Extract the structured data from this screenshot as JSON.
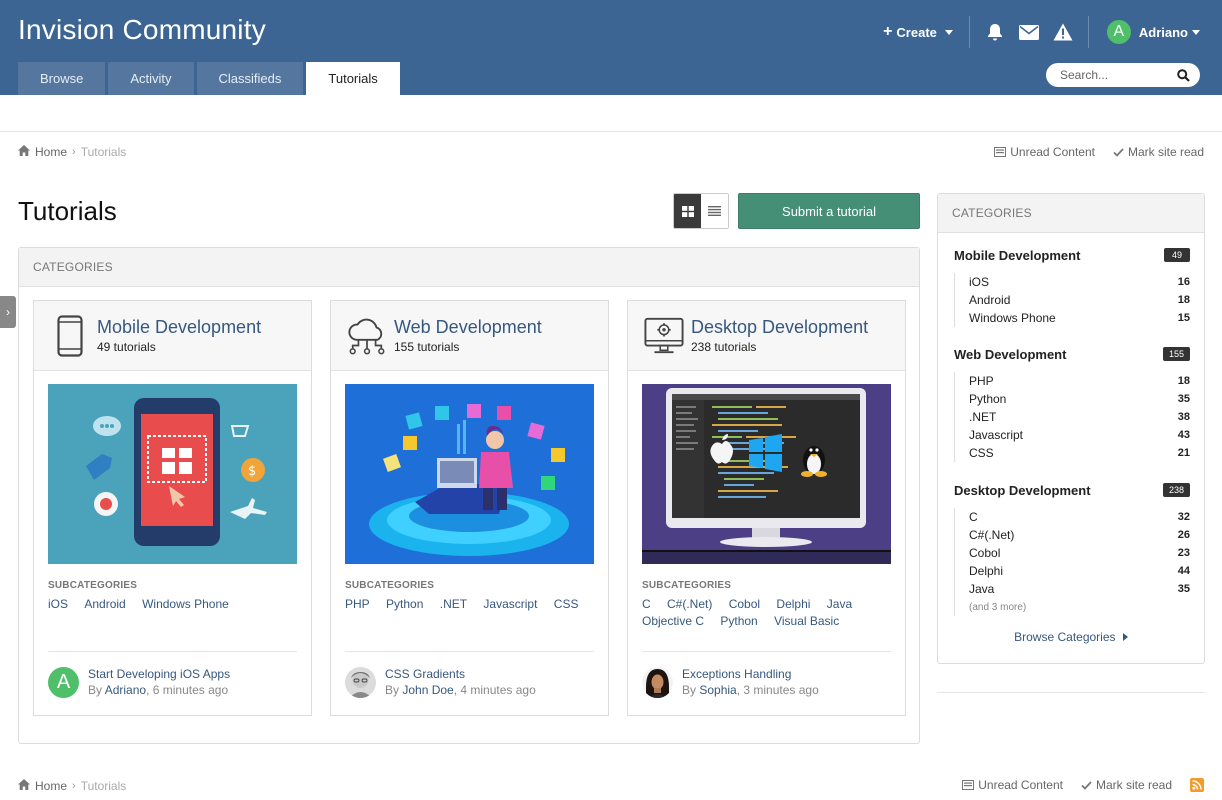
{
  "header": {
    "site_title": "Invision Community",
    "create_label": "Create",
    "user_name": "Adriano",
    "user_initial": "A",
    "search_placeholder": "Search..."
  },
  "nav": {
    "tabs": [
      {
        "label": "Browse",
        "active": false
      },
      {
        "label": "Activity",
        "active": false
      },
      {
        "label": "Classifieds",
        "active": false
      },
      {
        "label": "Tutorials",
        "active": true
      }
    ]
  },
  "breadcrumb": {
    "home": "Home",
    "current": "Tutorials",
    "unread": "Unread Content",
    "mark_read": "Mark site read"
  },
  "page": {
    "title": "Tutorials",
    "submit_label": "Submit a tutorial",
    "categories_header": "CATEGORIES",
    "subcategories_label": "SUBCATEGORIES"
  },
  "cards": [
    {
      "title": "Mobile Development",
      "count": "49 tutorials",
      "subs": [
        "iOS",
        "Android",
        "Windows Phone"
      ],
      "latest_title": "Start Developing iOS Apps",
      "latest_by": "By ",
      "latest_author": "Adriano",
      "latest_time": ", 6 minutes ago",
      "latest_initial": "A"
    },
    {
      "title": "Web Development",
      "count": "155 tutorials",
      "subs": [
        "PHP",
        "Python",
        ".NET",
        "Javascript",
        "CSS"
      ],
      "latest_title": "CSS Gradients",
      "latest_by": "By ",
      "latest_author": "John Doe",
      "latest_time": ", 4 minutes ago"
    },
    {
      "title": "Desktop Development",
      "count": "238 tutorials",
      "subs": [
        "C",
        "C#(.Net)",
        "Cobol",
        "Delphi",
        "Java",
        "Objective C",
        "Python",
        "Visual Basic"
      ],
      "latest_title": "Exceptions Handling",
      "latest_by": "By ",
      "latest_author": "Sophia",
      "latest_time": ", 3 minutes ago"
    }
  ],
  "sidebar": {
    "header": "CATEGORIES",
    "categories": [
      {
        "name": "Mobile Development",
        "badge": "49",
        "subs": [
          [
            "iOS",
            "16"
          ],
          [
            "Android",
            "18"
          ],
          [
            "Windows Phone",
            "15"
          ]
        ]
      },
      {
        "name": "Web Development",
        "badge": "155",
        "subs": [
          [
            "PHP",
            "18"
          ],
          [
            "Python",
            "35"
          ],
          [
            ".NET",
            "38"
          ],
          [
            "Javascript",
            "43"
          ],
          [
            "CSS",
            "21"
          ]
        ]
      },
      {
        "name": "Desktop Development",
        "badge": "238",
        "subs": [
          [
            "C",
            "32"
          ],
          [
            "C#(.Net)",
            "26"
          ],
          [
            "Cobol",
            "23"
          ],
          [
            "Delphi",
            "44"
          ],
          [
            "Java",
            "35"
          ]
        ],
        "more": "(and 3 more)"
      }
    ],
    "browse_label": "Browse Categories"
  },
  "colors": {
    "header_bg": "#3d6594",
    "accent_link": "#36587f",
    "submit_bg": "#468f77"
  }
}
